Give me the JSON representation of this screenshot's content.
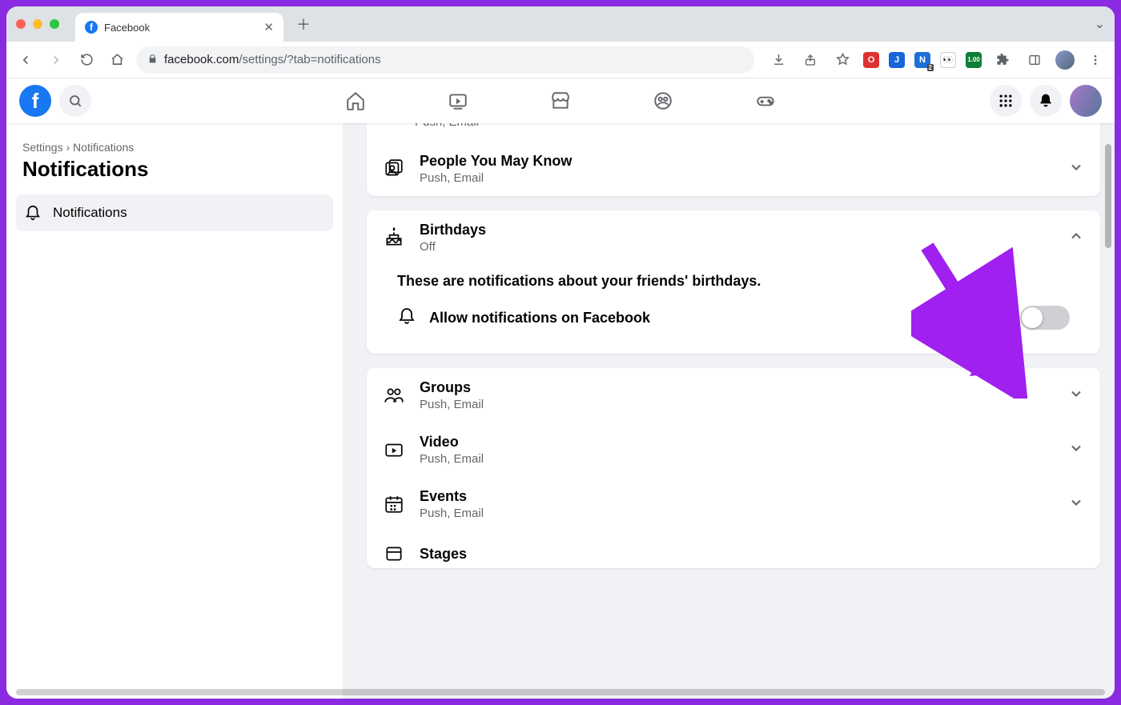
{
  "browser": {
    "tab_title": "Facebook",
    "url_host": "facebook.com",
    "url_path": "/settings/?tab=notifications"
  },
  "fb": {
    "breadcrumb_root": "Settings",
    "breadcrumb_sep": "›",
    "breadcrumb_leaf": "Notifications",
    "page_title": "Notifications",
    "sidebar_item": "Notifications"
  },
  "sections": {
    "partial_top_sub": "Push, Email",
    "pymk": {
      "title": "People You May Know",
      "sub": "Push, Email"
    },
    "birthdays": {
      "title": "Birthdays",
      "sub": "Off",
      "explain": "These are notifications about your friends' birthdays.",
      "toggle_label": "Allow notifications on Facebook"
    },
    "groups": {
      "title": "Groups",
      "sub": "Push, Email"
    },
    "video": {
      "title": "Video",
      "sub": "Push, Email"
    },
    "events": {
      "title": "Events",
      "sub": "Push, Email"
    },
    "stages": {
      "title": "Stages"
    }
  }
}
